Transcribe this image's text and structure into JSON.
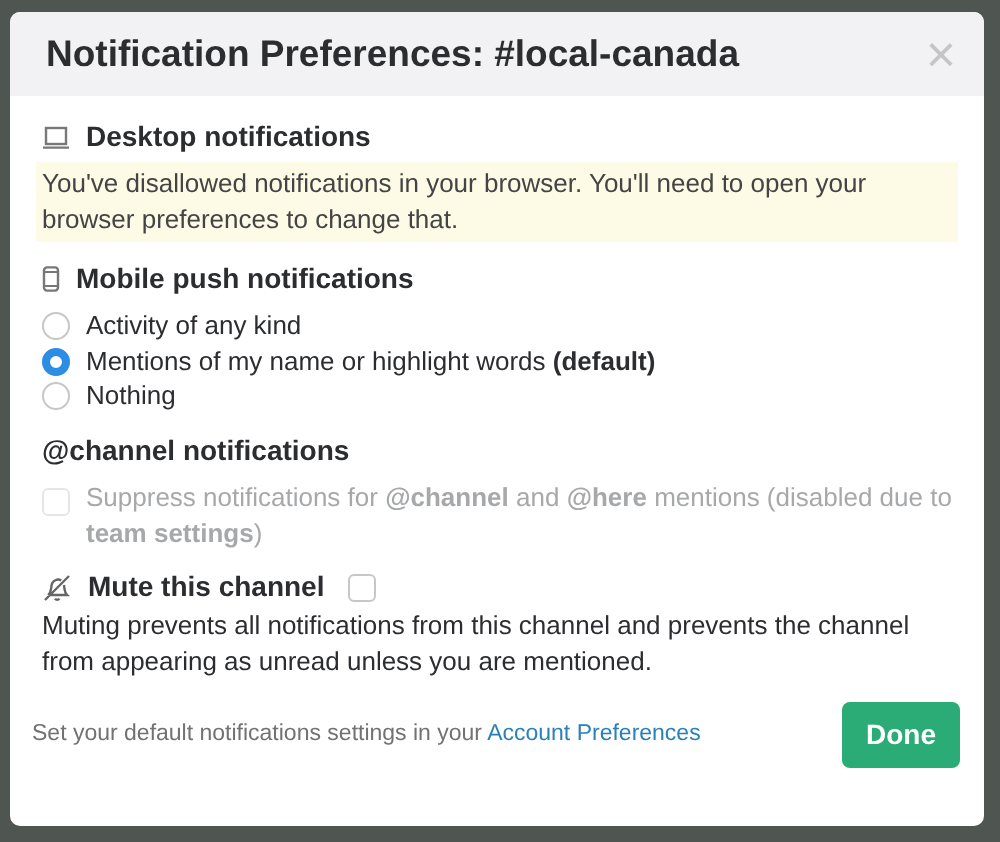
{
  "dialog": {
    "title": "Notification Preferences: #local-canada",
    "close": "×"
  },
  "desktop": {
    "heading": "Desktop notifications",
    "warning": "You've disallowed notifications in your browser. You'll need to open your browser preferences to change that."
  },
  "mobile": {
    "heading": "Mobile push notifications",
    "options": [
      {
        "label": "Activity of any kind",
        "selected": false
      },
      {
        "label": "Mentions of my name or highlight words **(default)**",
        "selected": true
      },
      {
        "label": "Nothing",
        "selected": false
      }
    ]
  },
  "channel": {
    "heading": "@channel notifications",
    "suppress": {
      "label": "Suppress notifications for **@channel** and **@here** mentions (disabled due to **team settings**)",
      "checked": false,
      "disabled": true
    }
  },
  "mute": {
    "label": "Mute this channel",
    "checked": false,
    "description": "Muting prevents all notifications from this channel and prevents the channel from appearing as unread unless you are mentioned."
  },
  "footer": {
    "text": "Set your default notifications settings in your",
    "link": "Account Preferences",
    "button": "Done"
  }
}
